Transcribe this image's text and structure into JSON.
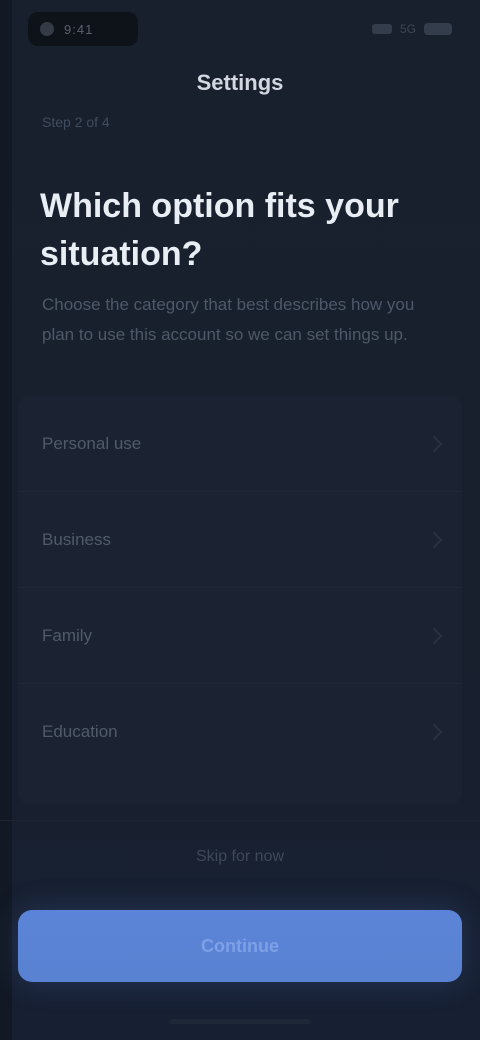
{
  "status_bar": {
    "time": "9:41",
    "right_text": "5G"
  },
  "header": {
    "title": "Settings",
    "step_label": "Step 2 of 4"
  },
  "content": {
    "heading": "Which option fits your situation?",
    "description": "Choose the category that best describes how you plan to use this account so we can set things up."
  },
  "options": [
    {
      "label": "Personal use"
    },
    {
      "label": "Business"
    },
    {
      "label": "Family"
    },
    {
      "label": "Education"
    }
  ],
  "footer": {
    "secondary_label": "Skip for now",
    "primary_label": "Continue"
  },
  "colors": {
    "background": "#19202d",
    "accent": "#5b84d8"
  }
}
